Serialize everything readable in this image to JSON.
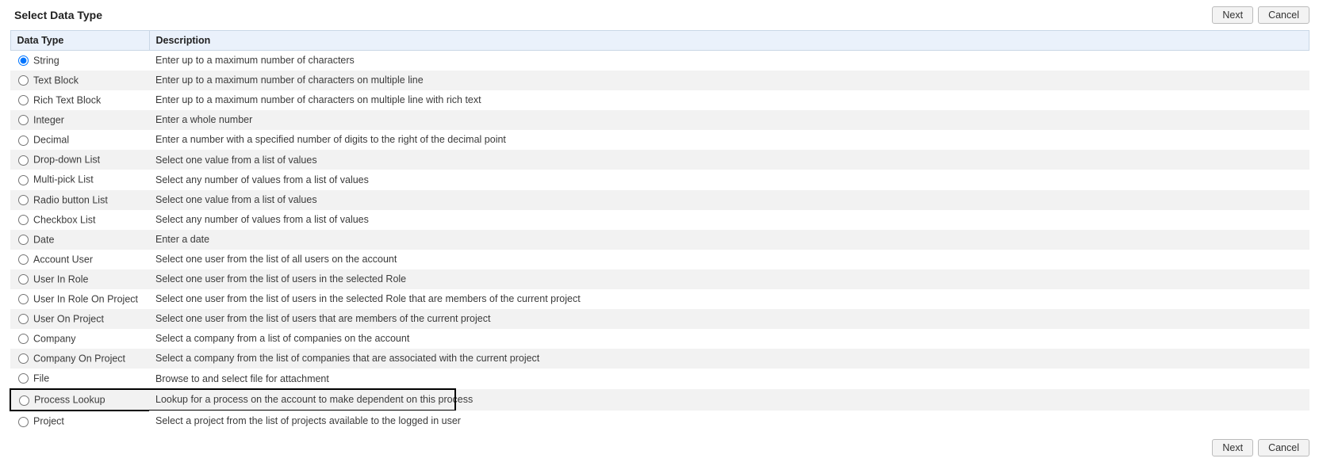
{
  "header": {
    "title": "Select Data Type",
    "buttons": {
      "next": "Next",
      "cancel": "Cancel"
    }
  },
  "table": {
    "columns": {
      "type": "Data Type",
      "description": "Description"
    },
    "rows": [
      {
        "label": "String",
        "desc": "Enter up to a maximum number of characters",
        "selected": true
      },
      {
        "label": "Text Block",
        "desc": "Enter up to a maximum number of characters on multiple line"
      },
      {
        "label": "Rich Text Block",
        "desc": "Enter up to a maximum number of characters on multiple line with rich text"
      },
      {
        "label": "Integer",
        "desc": "Enter a whole number"
      },
      {
        "label": "Decimal",
        "desc": "Enter a number with a specified number of digits to the right of the decimal point"
      },
      {
        "label": "Drop-down List",
        "desc": "Select one value from a list of values"
      },
      {
        "label": "Multi-pick List",
        "desc": "Select any number of values from a list of values"
      },
      {
        "label": "Radio button List",
        "desc": "Select one value from a list of values"
      },
      {
        "label": "Checkbox List",
        "desc": "Select any number of values from a list of values"
      },
      {
        "label": "Date",
        "desc": "Enter a date"
      },
      {
        "label": "Account User",
        "desc": "Select one user from the list of all users on the account"
      },
      {
        "label": "User In Role",
        "desc": "Select one user from the list of users in the selected Role"
      },
      {
        "label": "User In Role On Project",
        "desc": "Select one user from the list of users in the selected Role that are members of the current project"
      },
      {
        "label": "User On Project",
        "desc": "Select one user from the list of users that are members of the current project"
      },
      {
        "label": "Company",
        "desc": "Select a company from a list of companies on the account"
      },
      {
        "label": "Company On Project",
        "desc": "Select a company from the list of companies that are associated with the current project"
      },
      {
        "label": "File",
        "desc": "Browse to and select file for attachment"
      },
      {
        "label": "Process Lookup",
        "desc": "Lookup for a process on the account to make dependent on this process",
        "highlighted": true
      },
      {
        "label": "Project",
        "desc": "Select a project from the list of projects available to the logged in user"
      }
    ]
  },
  "footer": {
    "buttons": {
      "next": "Next",
      "cancel": "Cancel"
    }
  }
}
